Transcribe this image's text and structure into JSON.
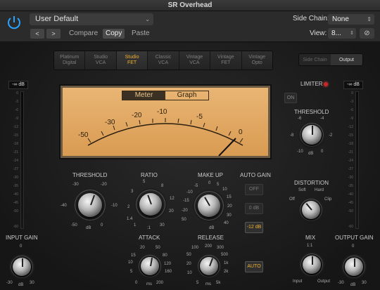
{
  "window": {
    "title": "SR Overhead"
  },
  "header": {
    "preset": "User Default",
    "prev": "<",
    "next": ">",
    "compare": "Compare",
    "copy": "Copy",
    "paste": "Paste",
    "side_chain_label": "Side Chain:",
    "side_chain_value": "None",
    "view_label": "View:",
    "view_value": "8...",
    "link_glyph": "⊘"
  },
  "circuits": [
    {
      "line1": "Platinum",
      "line2": "Digital",
      "active": false
    },
    {
      "line1": "Studio",
      "line2": "VCA",
      "active": false
    },
    {
      "line1": "Studio",
      "line2": "FET",
      "active": true
    },
    {
      "line1": "Classic",
      "line2": "VCA",
      "active": false
    },
    {
      "line1": "Vintage",
      "line2": "VCA",
      "active": false
    },
    {
      "line1": "Vintage",
      "line2": "FET",
      "active": false
    },
    {
      "line1": "Vintage",
      "line2": "Opto",
      "active": false
    }
  ],
  "view_toggle": {
    "side_chain": "Side Chain",
    "output": "Output"
  },
  "meter": {
    "tab_meter": "Meter",
    "tab_graph": "Graph",
    "scale": [
      "-50",
      "-30",
      "-20",
      "-10",
      "-5",
      "0"
    ]
  },
  "input_meter": {
    "readout": "-∞ dB",
    "label": "INPUT GAIN",
    "ticks": [
      "0",
      "-30",
      "dB",
      "30"
    ]
  },
  "output_meter": {
    "readout": "-∞ dB",
    "label": "OUTPUT GAIN",
    "ticks": [
      "0",
      "-30",
      "dB",
      "30"
    ]
  },
  "meter_scale": [
    "0",
    "-3",
    "-6",
    "-9",
    "-12",
    "-15",
    "-18",
    "-21",
    "-24",
    "-27",
    "-30",
    "-35",
    "-40",
    "-45",
    "-50",
    "-60"
  ],
  "threshold": {
    "label": "THRESHOLD",
    "ticks": [
      "-30",
      "-20",
      "-40",
      "-10",
      "-50",
      "0",
      "dB"
    ]
  },
  "ratio": {
    "label": "RATIO",
    "ticks": [
      "5",
      "8",
      "3",
      "12",
      "2",
      "20",
      "1.4",
      "30",
      "1",
      ":1"
    ]
  },
  "makeup": {
    "label": "MAKE UP",
    "ticks": [
      "0",
      "5",
      "-5",
      "10",
      "-10",
      "15",
      "-15",
      "20",
      "-20",
      "30",
      "dB",
      "40",
      "50"
    ]
  },
  "auto_gain": {
    "label": "AUTO GAIN",
    "off": "OFF",
    "zero": "0 dB",
    "minus12": "-12 dB"
  },
  "attack": {
    "label": "ATTACK",
    "ticks": [
      "20",
      "50",
      "15",
      "80",
      "10",
      "120",
      "5",
      "160",
      "0",
      "ms",
      "200"
    ]
  },
  "release": {
    "label": "RELEASE",
    "ticks": [
      "100",
      "200",
      "300",
      "50",
      "500",
      "20",
      "1k",
      "10",
      "2k",
      "5",
      "5k",
      "ms"
    ]
  },
  "auto_btn": "AUTO",
  "limiter": {
    "label": "LIMITER",
    "on": "ON"
  },
  "lim_threshold": {
    "label": "THRESHOLD",
    "ticks": [
      "-6",
      "-4",
      "-8",
      "-2",
      "-10",
      "0",
      "dB"
    ]
  },
  "distortion": {
    "label": "DISTORTION",
    "soft": "Soft",
    "hard": "Hard",
    "off": "Off",
    "clip": "Clip"
  },
  "mix": {
    "label": "MIX",
    "ratio": "1:1",
    "input": "Input",
    "output": "Output"
  }
}
